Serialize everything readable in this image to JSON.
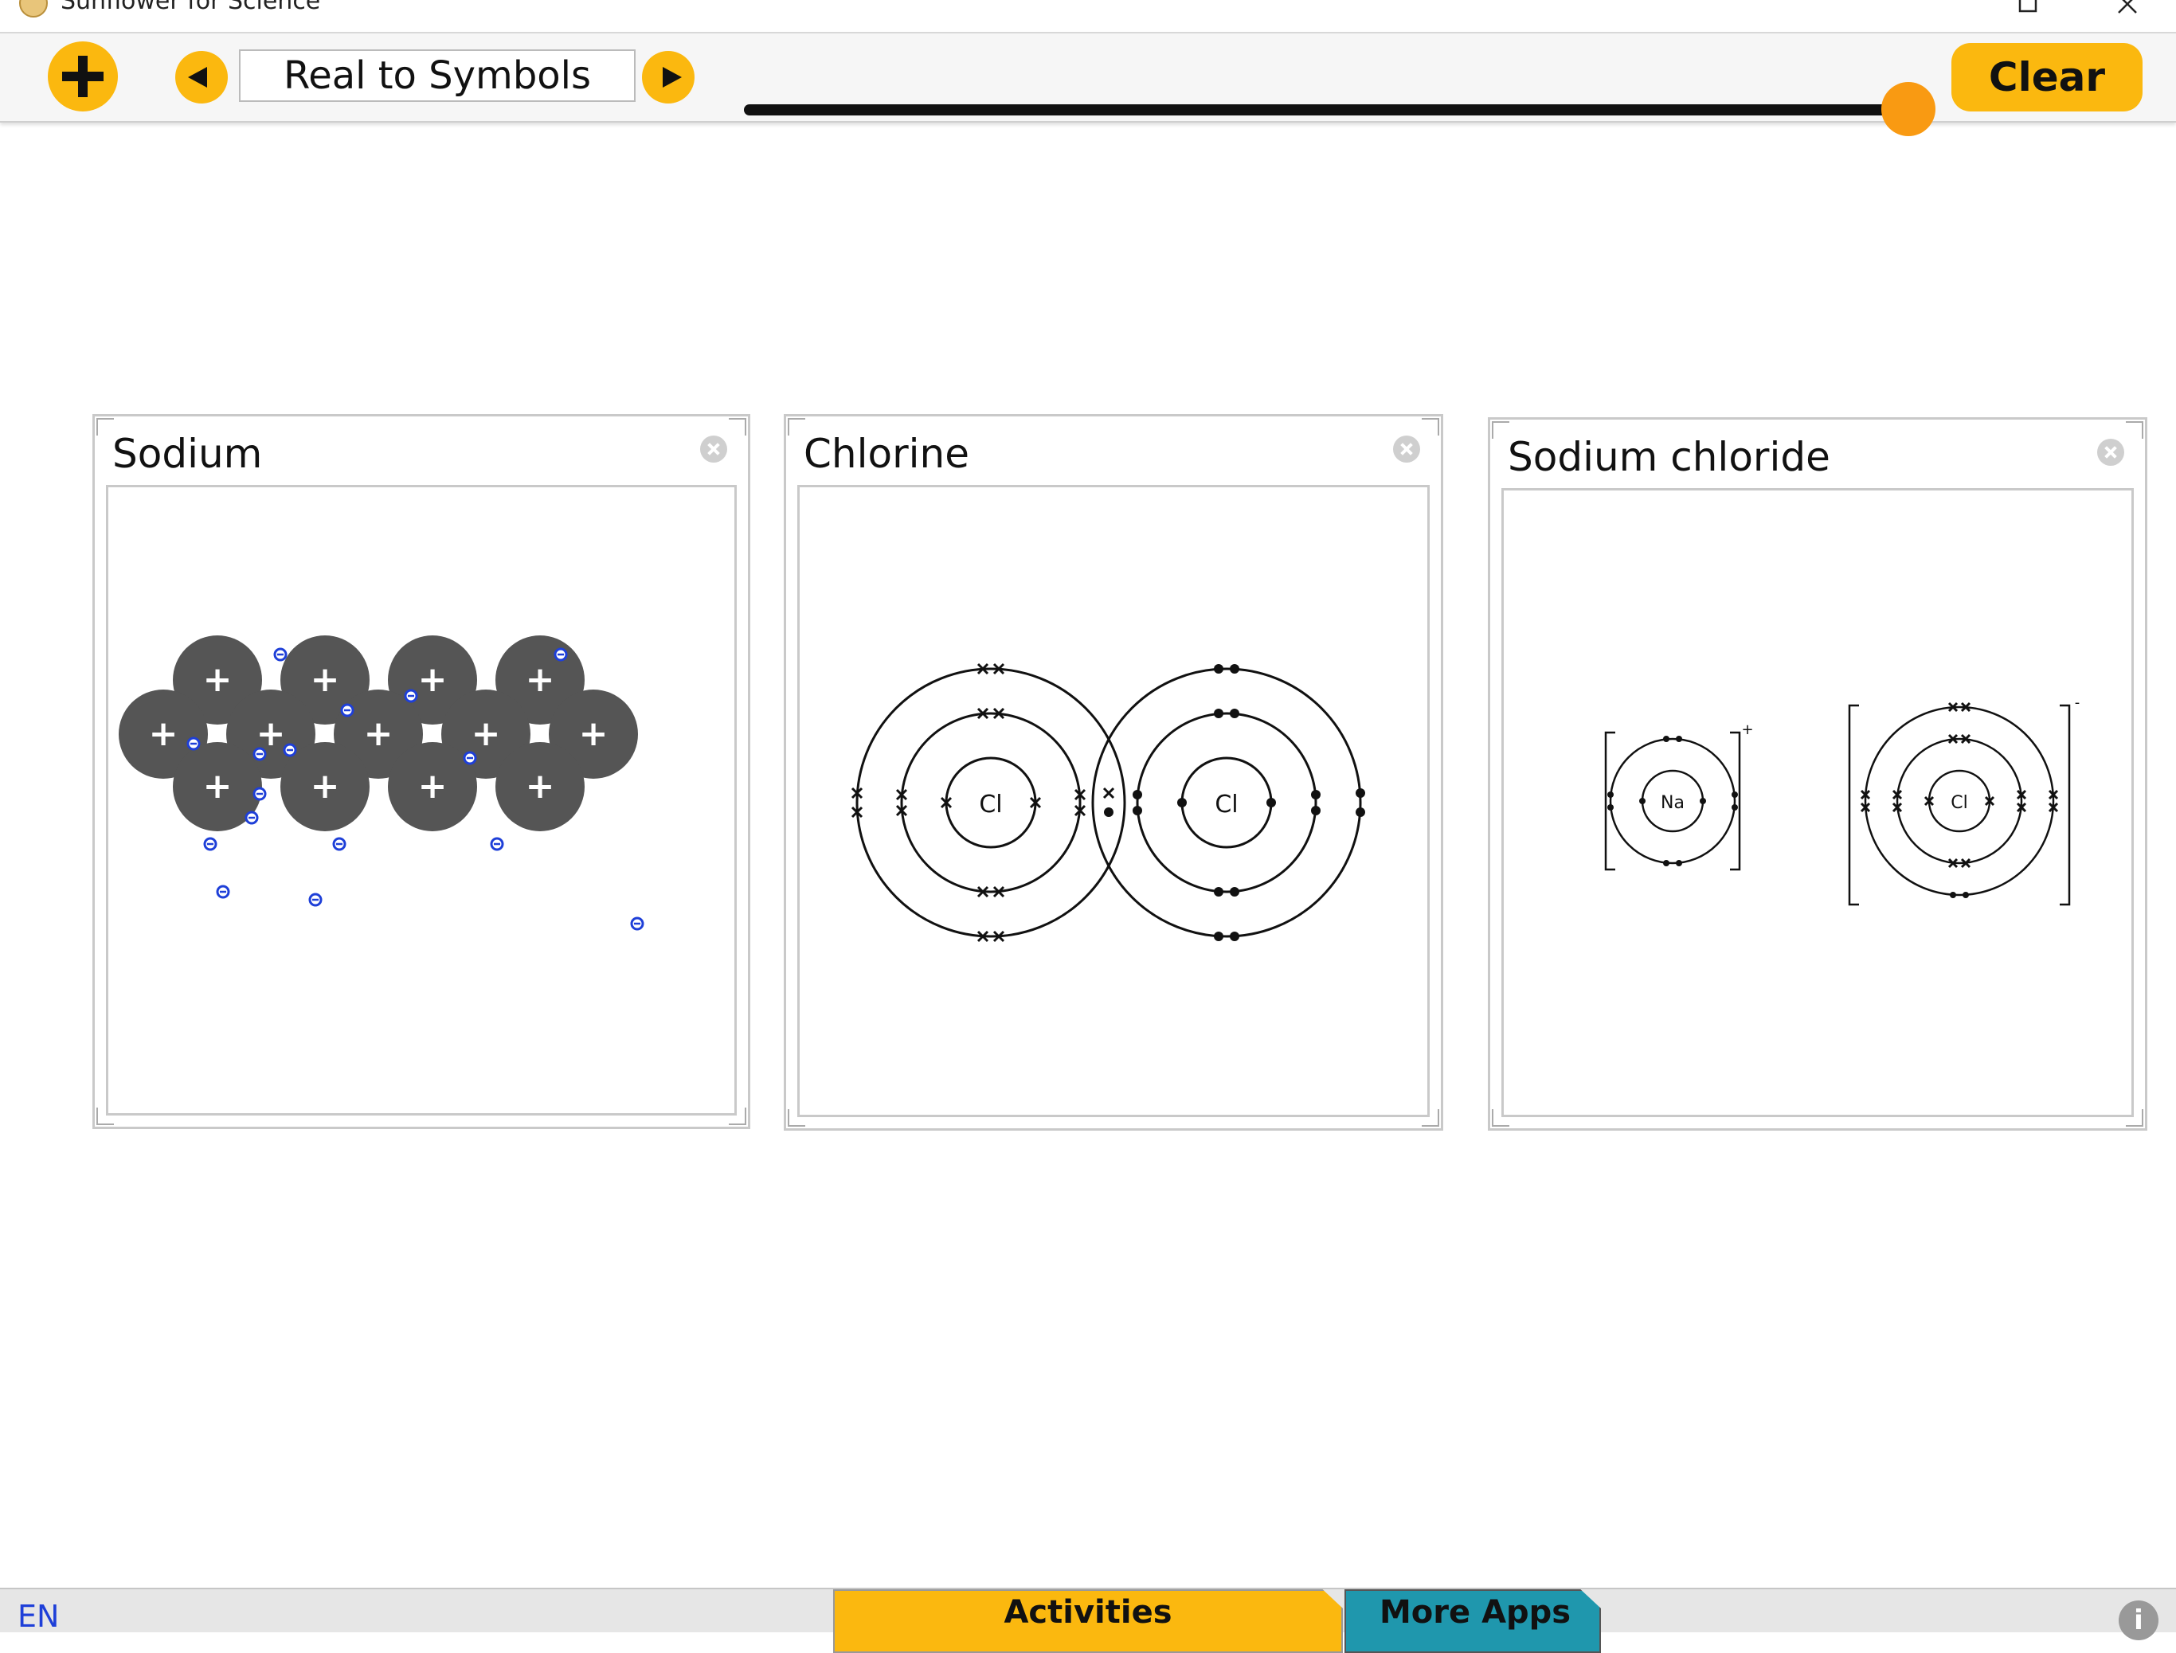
{
  "window": {
    "title": "Sunflower for Science"
  },
  "toolbar": {
    "activity_name": "Real to Symbols",
    "clear_label": "Clear",
    "slider_value_percent": 98
  },
  "cards": [
    {
      "title": "Sodium"
    },
    {
      "title": "Chlorine",
      "atom_labels": [
        "Cl",
        "Cl"
      ]
    },
    {
      "title": "Sodium chloride",
      "ion_labels": [
        "Na",
        "Cl"
      ],
      "charges": [
        "+",
        "-"
      ]
    }
  ],
  "sodium_lattice": {
    "ion_symbol": "+",
    "electron_symbol": "-",
    "ion_rows": [
      4,
      5,
      4
    ],
    "free_electron_count": 16
  },
  "bottom": {
    "language": "EN",
    "tabs": [
      "Activities",
      "More Apps"
    ],
    "info_symbol": "i"
  },
  "colors": {
    "accent": "#fbb80f",
    "slider_handle": "#f99a12",
    "tab_more_apps": "#1f97ad",
    "ion": "#555555",
    "electron": "#1e3fd8",
    "link": "#1e3fd8"
  },
  "icons": [
    "app-icon",
    "plus-icon",
    "arrow-left-icon",
    "arrow-right-icon",
    "close-icon",
    "maximize-icon",
    "info-icon"
  ]
}
